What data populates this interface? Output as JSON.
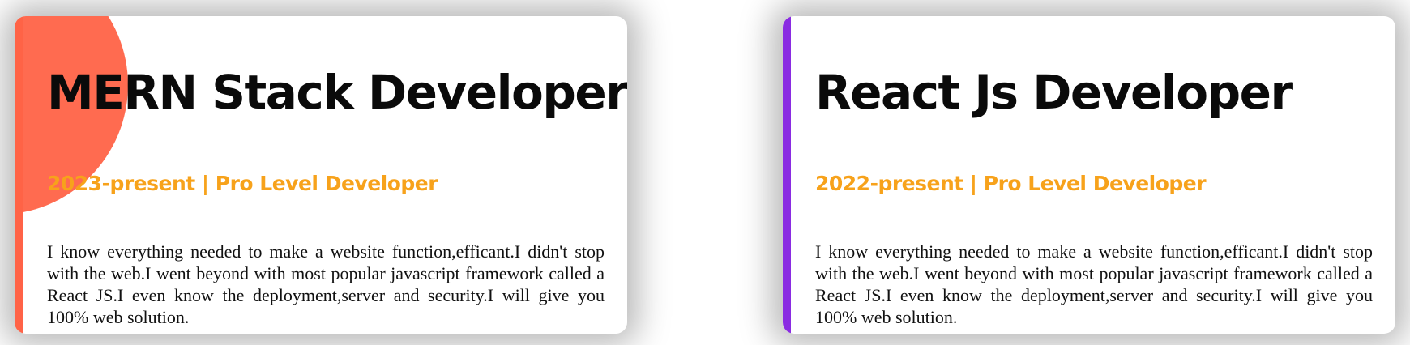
{
  "cards": [
    {
      "title": "MERN Stack Developer",
      "subtitle": "2023-present | Pro Level Developer",
      "description": "I know everything needed to make a website function,efficant.I didn't stop with the web.I went beyond with most popular javascript framework called a React JS.I even know the deployment,server and security.I will give you 100% web solution.",
      "accent_color": "#ff6347"
    },
    {
      "title": "React Js Developer",
      "subtitle": "2022-present | Pro Level Developer",
      "description": "I know everything needed to make a website function,efficant.I didn't stop with the web.I went beyond with most popular javascript framework called a React JS.I even know the deployment,server and security.I will give you 100% web solution.",
      "accent_color": "#8a2be2"
    }
  ],
  "colors": {
    "subtitle": "#f7a21b",
    "title": "#0a0a0a",
    "card_background": "#ffffff"
  }
}
